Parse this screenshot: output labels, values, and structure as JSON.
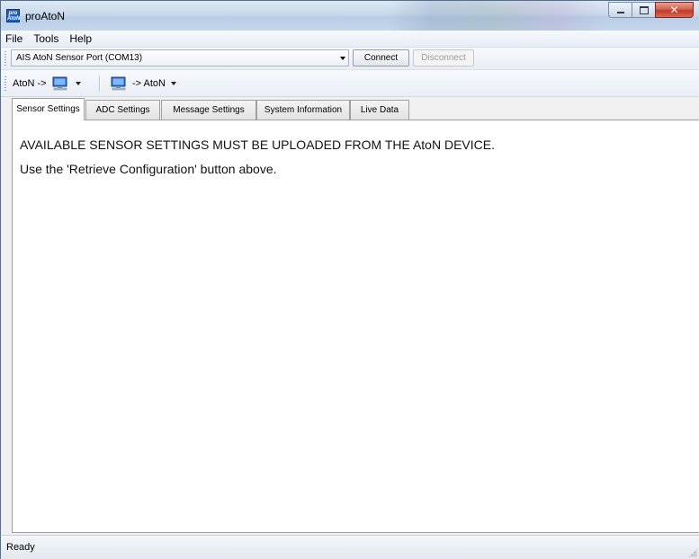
{
  "window": {
    "title": "proAtoN",
    "logo_text": "pro\nAtoN"
  },
  "menu": {
    "items": [
      "File",
      "Tools",
      "Help"
    ]
  },
  "toolbar": {
    "port_selected": "AIS AtoN Sensor Port (COM13)",
    "connect_label": "Connect",
    "disconnect_label": "Disconnect"
  },
  "actions": {
    "from_aton_label": "AtoN ->",
    "to_aton_label": "-> AtoN"
  },
  "tabs": [
    {
      "label": "Sensor Settings",
      "active": true
    },
    {
      "label": "ADC Settings",
      "active": false
    },
    {
      "label": "Message Settings",
      "active": false
    },
    {
      "label": "System Information",
      "active": false
    },
    {
      "label": "Live Data",
      "active": false
    }
  ],
  "content": {
    "notice": "AVAILABLE SENSOR SETTINGS MUST BE UPLOADED FROM THE AtoN DEVICE.",
    "hint": "Use the 'Retrieve Configuration' button above."
  },
  "status": {
    "text": "Ready"
  },
  "colors": {
    "accent": "#1d5fb8",
    "close_button": "#c0392b",
    "disabled_text": "#9b9b9b"
  }
}
